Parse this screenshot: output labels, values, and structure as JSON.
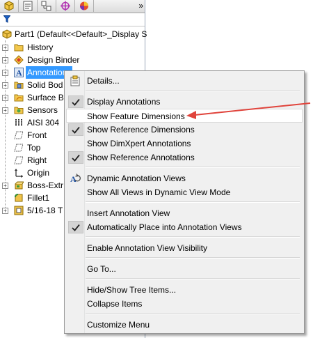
{
  "panel": {
    "tabs": [
      {
        "icon": "feature-manager-icon"
      },
      {
        "icon": "property-manager-icon"
      },
      {
        "icon": "configuration-manager-icon"
      },
      {
        "icon": "dimxpert-manager-icon"
      },
      {
        "icon": "display-manager-icon"
      }
    ],
    "more": "»",
    "filter_icon": "filter-icon",
    "root": {
      "label": "Part1  (Default<<Default>_Display S",
      "icon": "part-icon"
    },
    "items": [
      {
        "label": "History",
        "icon": "history-folder-icon",
        "expandable": true
      },
      {
        "label": "Design Binder",
        "icon": "design-binder-icon",
        "expandable": true
      },
      {
        "label": "Annotations",
        "icon": "annotations-icon",
        "expandable": true,
        "selected": true
      },
      {
        "label": "Solid Bod",
        "icon": "solid-bodies-icon",
        "expandable": true
      },
      {
        "label": "Surface B",
        "icon": "surface-bodies-icon",
        "expandable": true
      },
      {
        "label": "Sensors",
        "icon": "sensors-icon",
        "expandable": true
      },
      {
        "label": "AISI 304",
        "icon": "material-icon",
        "expandable": false
      },
      {
        "label": "Front",
        "icon": "plane-icon",
        "expandable": false
      },
      {
        "label": "Top",
        "icon": "plane-icon",
        "expandable": false
      },
      {
        "label": "Right",
        "icon": "plane-icon",
        "expandable": false
      },
      {
        "label": "Origin",
        "icon": "origin-icon",
        "expandable": false
      },
      {
        "label": "Boss-Extr",
        "icon": "extrude-icon",
        "expandable": true
      },
      {
        "label": "Fillet1",
        "icon": "fillet-icon",
        "expandable": false
      },
      {
        "label": "5/16-18 T",
        "icon": "hole-icon",
        "expandable": true
      }
    ]
  },
  "menu": {
    "items": [
      {
        "label": "Details...",
        "icon": "details-icon",
        "checked": false
      },
      {
        "label": "Display Annotations",
        "checked": true
      },
      {
        "label": "Show Feature Dimensions",
        "checked": false,
        "hover": true
      },
      {
        "label": "Show Reference Dimensions",
        "checked": true
      },
      {
        "label": "Show DimXpert Annotations",
        "checked": false
      },
      {
        "label": "Show Reference Annotations",
        "checked": true
      },
      {
        "label": "Dynamic Annotation Views",
        "icon": "dynamic-views-icon",
        "checked": false
      },
      {
        "label": "Show All Views in Dynamic View Mode",
        "checked": false
      },
      {
        "label": "Insert Annotation View",
        "checked": false
      },
      {
        "label": "Automatically Place into Annotation Views",
        "checked": true
      },
      {
        "label": "Enable Annotation View Visibility",
        "checked": false
      },
      {
        "label": "Go To...",
        "checked": false
      },
      {
        "label": "Hide/Show Tree Items...",
        "checked": false
      },
      {
        "label": "Collapse Items",
        "checked": false
      },
      {
        "label": "Customize Menu",
        "checked": false
      }
    ]
  },
  "colors": {
    "selection": "#3399ff",
    "arrow": "#e0443c",
    "menu_bg": "#f0f0f0"
  }
}
